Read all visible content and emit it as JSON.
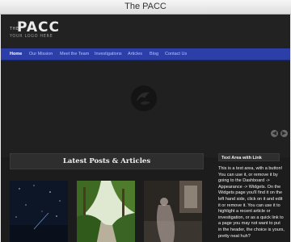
{
  "window": {
    "title": "The PACC"
  },
  "logo": {
    "prefix": "THE",
    "name": "PACC",
    "tagline": "YOUR LOGO HERE"
  },
  "nav": {
    "items": [
      {
        "label": "Home",
        "active": true
      },
      {
        "label": "Our Mission",
        "active": false
      },
      {
        "label": "Meet the Team",
        "active": false
      },
      {
        "label": "Investigations",
        "active": false
      },
      {
        "label": "Articles",
        "active": false
      },
      {
        "label": "Blog",
        "active": false
      },
      {
        "label": "Contact Us",
        "active": false
      }
    ]
  },
  "slider": {
    "prev_icon": "arrow-left-icon",
    "next_icon": "arrow-right-icon"
  },
  "posts": {
    "heading": "Latest Posts & Articles",
    "thumbnails": [
      "night-sky-image",
      "forest-path-image",
      "ghostly-figure-image"
    ]
  },
  "sidebar": {
    "widget_title": "Text Area with Link",
    "widget_text": "This is a text area, with a button! You can use it, or remove it by going to the Dashboard -> Appearance -> Widgets. On the Widgets page you'll find it on the left hand side, click on it and edit it or remove it. You can use it to highlight a recent article or investigation, or as a quick link to a page you may not want to put in the header, the choice is yours, pretty neat huh?"
  },
  "colors": {
    "nav_bar": "#2c3ea8",
    "page_bg": "#1c1c1c",
    "text": "#f2f2f2"
  }
}
